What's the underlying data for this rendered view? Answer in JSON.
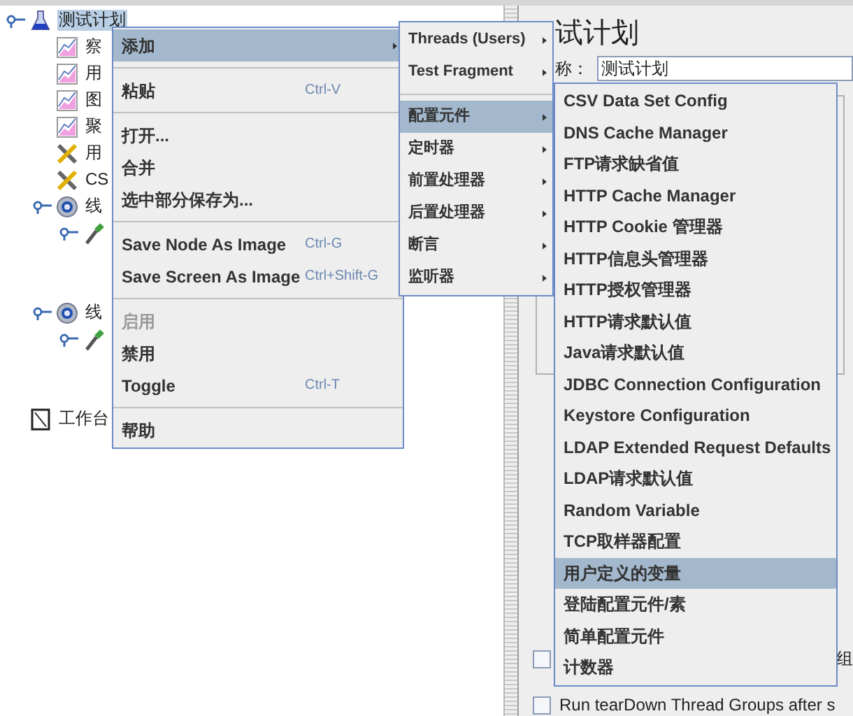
{
  "tree": [
    {
      "label": "测试计划",
      "kind": "flask",
      "selected": true,
      "expanded": true,
      "children": [
        {
          "label": "察",
          "kind": "chart",
          "selected": false
        },
        {
          "label": "用",
          "kind": "chart",
          "selected": false
        },
        {
          "label": "图",
          "kind": "chart",
          "selected": false
        },
        {
          "label": "聚",
          "kind": "chart",
          "selected": false
        },
        {
          "label": "用",
          "kind": "wrench",
          "selected": false
        },
        {
          "label": "CS",
          "kind": "wrench",
          "selected": false
        },
        {
          "label": "线",
          "kind": "gear",
          "selected": false,
          "expanded": true,
          "children": [
            {
              "kind": "pipette",
              "expanded": true
            }
          ]
        },
        {
          "label": "线",
          "kind": "gear",
          "selected": false,
          "expanded": true,
          "children": [
            {
              "kind": "pipette",
              "expanded": true
            }
          ]
        }
      ]
    },
    {
      "label": "工作台",
      "kind": "notebook",
      "selected": false
    }
  ],
  "panel": {
    "title": "试计划",
    "name_label": "称：",
    "name_value": "测试计划",
    "options": [
      {
        "label": "组",
        "checked": false
      },
      {
        "label": "Run tearDown Thread Groups after s",
        "checked": false
      }
    ]
  },
  "context_menu": [
    {
      "kind": "item",
      "label": "添加",
      "submenu": true,
      "selected": true
    },
    {
      "kind": "separator"
    },
    {
      "kind": "item",
      "label": "粘贴",
      "shortcut": "Ctrl-V",
      "selected": false
    },
    {
      "kind": "separator"
    },
    {
      "kind": "item",
      "label": "打开...",
      "selected": false
    },
    {
      "kind": "item",
      "label": "合并",
      "selected": false
    },
    {
      "kind": "item",
      "label": "选中部分保存为...",
      "selected": false
    },
    {
      "kind": "separator"
    },
    {
      "kind": "item",
      "label": "Save Node As Image",
      "shortcut": "Ctrl-G",
      "selected": false
    },
    {
      "kind": "item",
      "label": "Save Screen As Image",
      "shortcut": "Ctrl+Shift-G",
      "selected": false
    },
    {
      "kind": "separator"
    },
    {
      "kind": "item",
      "label": "启用",
      "disabled": true,
      "selected": false
    },
    {
      "kind": "item",
      "label": "禁用",
      "selected": false
    },
    {
      "kind": "item",
      "label": "Toggle",
      "shortcut": "Ctrl-T",
      "selected": false
    },
    {
      "kind": "separator"
    },
    {
      "kind": "item",
      "label": "帮助",
      "selected": false
    }
  ],
  "add_submenu": [
    {
      "kind": "item",
      "label": "Threads (Users)",
      "submenu": true,
      "selected": false
    },
    {
      "kind": "item",
      "label": "Test Fragment",
      "submenu": true,
      "selected": false
    },
    {
      "kind": "separator"
    },
    {
      "kind": "item",
      "label": "配置元件",
      "submenu": true,
      "selected": true
    },
    {
      "kind": "item",
      "label": "定时器",
      "submenu": true,
      "selected": false
    },
    {
      "kind": "item",
      "label": "前置处理器",
      "submenu": true,
      "selected": false
    },
    {
      "kind": "item",
      "label": "后置处理器",
      "submenu": true,
      "selected": false
    },
    {
      "kind": "item",
      "label": "断言",
      "submenu": true,
      "selected": false
    },
    {
      "kind": "item",
      "label": "监听器",
      "submenu": true,
      "selected": false
    }
  ],
  "config_submenu": [
    {
      "kind": "item",
      "label": "CSV Data Set Config",
      "selected": false
    },
    {
      "kind": "item",
      "label": "DNS Cache Manager",
      "selected": false
    },
    {
      "kind": "item",
      "label": "FTP请求缺省值",
      "selected": false
    },
    {
      "kind": "item",
      "label": "HTTP Cache Manager",
      "selected": false
    },
    {
      "kind": "item",
      "label": "HTTP Cookie 管理器",
      "selected": false
    },
    {
      "kind": "item",
      "label": "HTTP信息头管理器",
      "selected": false
    },
    {
      "kind": "item",
      "label": "HTTP授权管理器",
      "selected": false
    },
    {
      "kind": "item",
      "label": "HTTP请求默认值",
      "selected": false
    },
    {
      "kind": "item",
      "label": "Java请求默认值",
      "selected": false
    },
    {
      "kind": "item",
      "label": "JDBC Connection Configuration",
      "selected": false
    },
    {
      "kind": "item",
      "label": "Keystore Configuration",
      "selected": false
    },
    {
      "kind": "item",
      "label": "LDAP Extended Request Defaults",
      "selected": false
    },
    {
      "kind": "item",
      "label": "LDAP请求默认值",
      "selected": false
    },
    {
      "kind": "item",
      "label": "Random Variable",
      "selected": false
    },
    {
      "kind": "item",
      "label": "TCP取样器配置",
      "selected": false
    },
    {
      "kind": "item",
      "label": "用户定义的变量",
      "selected": true
    },
    {
      "kind": "item",
      "label": "登陆配置元件/素",
      "selected": false
    },
    {
      "kind": "item",
      "label": "简单配置元件",
      "selected": false
    },
    {
      "kind": "item",
      "label": "计数器",
      "selected": false
    }
  ]
}
